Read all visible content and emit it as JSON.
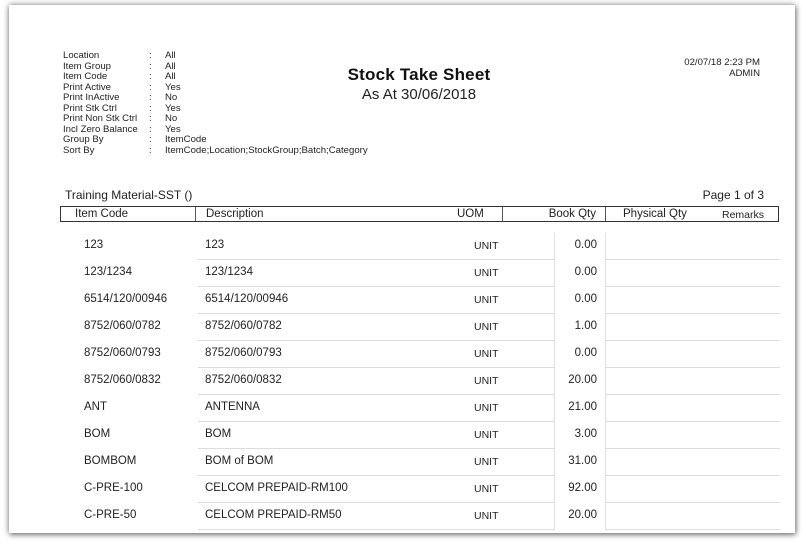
{
  "report": {
    "title": "Stock Take Sheet",
    "subtitle": "As At 30/06/2018",
    "datetime": "02/07/18 2:23 PM",
    "user": "ADMIN",
    "company": "Training Material-SST ()",
    "page": "Page 1 of 3"
  },
  "params": [
    {
      "label": "Location",
      "value": "All"
    },
    {
      "label": "Item Group",
      "value": "All"
    },
    {
      "label": "Item Code",
      "value": "All"
    },
    {
      "label": "Print Active",
      "value": "Yes"
    },
    {
      "label": "Print InActive",
      "value": "No"
    },
    {
      "label": "Print Stk Ctrl",
      "value": "Yes"
    },
    {
      "label": "Print Non Stk Ctrl",
      "value": "No"
    },
    {
      "label": "Incl Zero Balance",
      "value": "Yes"
    },
    {
      "label": "Group By",
      "value": "ItemCode"
    },
    {
      "label": "Sort By",
      "value": "ItemCode;Location;StockGroup;Batch;Category"
    }
  ],
  "columns": {
    "item_code": "Item Code",
    "description": "Description",
    "uom": "UOM",
    "book_qty": "Book Qty",
    "physical_qty": "Physical Qty",
    "remarks": "Remarks"
  },
  "rows": [
    {
      "code": "123",
      "desc": "123",
      "uom": "UNIT",
      "qty": "0.00"
    },
    {
      "code": "123/1234",
      "desc": "123/1234",
      "uom": "UNIT",
      "qty": "0.00"
    },
    {
      "code": "6514/120/00946",
      "desc": "6514/120/00946",
      "uom": "UNIT",
      "qty": "0.00"
    },
    {
      "code": "8752/060/0782",
      "desc": "8752/060/0782",
      "uom": "UNIT",
      "qty": "1.00"
    },
    {
      "code": "8752/060/0793",
      "desc": "8752/060/0793",
      "uom": "UNIT",
      "qty": "0.00"
    },
    {
      "code": "8752/060/0832",
      "desc": "8752/060/0832",
      "uom": "UNIT",
      "qty": "20.00"
    },
    {
      "code": "ANT",
      "desc": "ANTENNA",
      "uom": "UNIT",
      "qty": "21.00"
    },
    {
      "code": "BOM",
      "desc": "BOM",
      "uom": "UNIT",
      "qty": "3.00"
    },
    {
      "code": "BOMBOM",
      "desc": "BOM of BOM",
      "uom": "UNIT",
      "qty": "31.00"
    },
    {
      "code": "C-PRE-100",
      "desc": "CELCOM PREPAID-RM100",
      "uom": "UNIT",
      "qty": "92.00"
    },
    {
      "code": "C-PRE-50",
      "desc": "CELCOM PREPAID-RM50",
      "uom": "UNIT",
      "qty": "20.00"
    }
  ]
}
